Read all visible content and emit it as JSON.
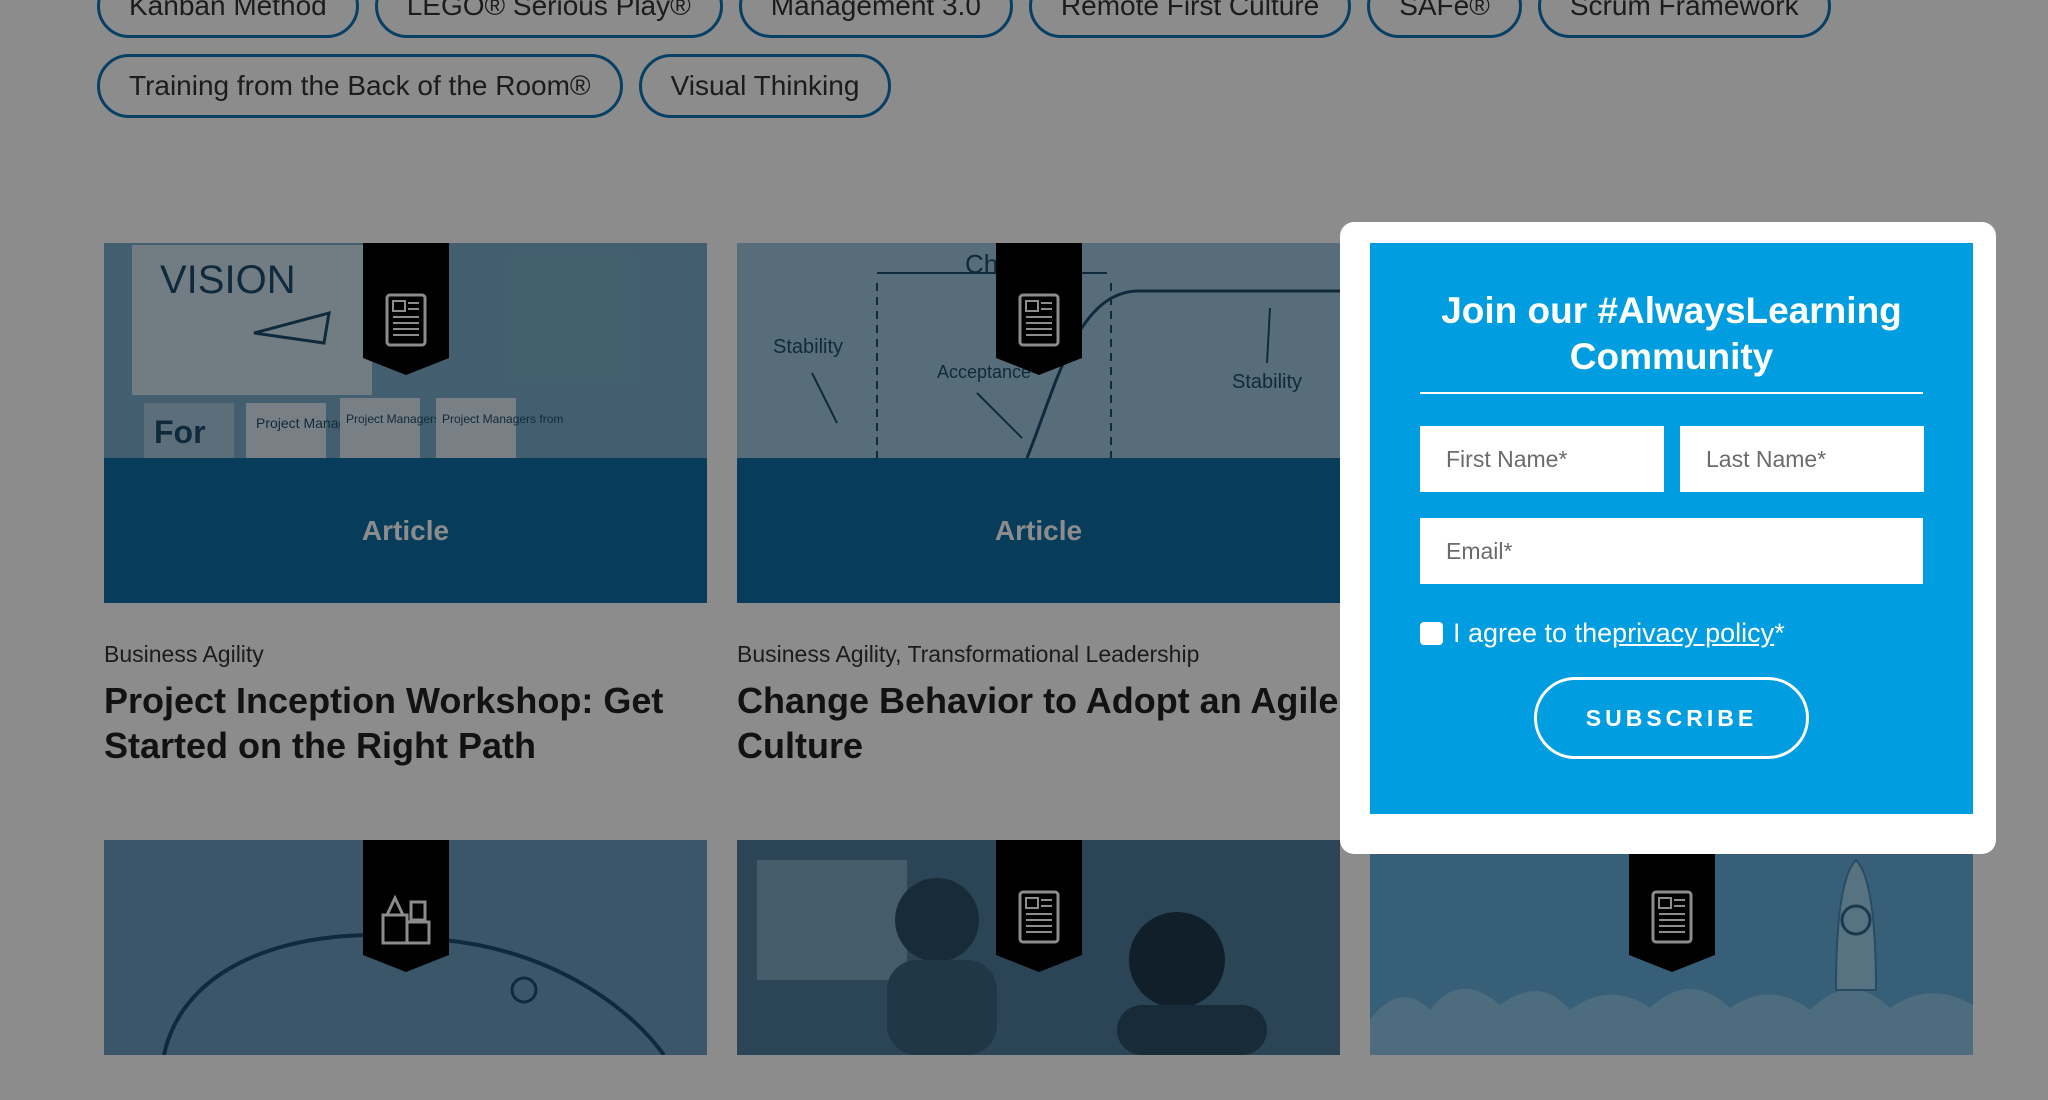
{
  "tags": {
    "row1": [
      "Kanban Method",
      "LEGO® Serious Play®",
      "Management 3.0",
      "Remote First Culture",
      "SAFe®",
      "Scrum Framework"
    ],
    "row2": [
      "Training from the Back of the Room®",
      "Visual Thinking"
    ]
  },
  "cards": [
    {
      "type": "Article",
      "categories": "Business Agility",
      "title": "Project Inception Workshop: Get Started on the Right Path",
      "image_text": {
        "vision": "VISION",
        "for": "For",
        "sticky1": "Project Managers",
        "sticky2": "Project Managers from other",
        "sticky3": "Project Managers from"
      },
      "icon": "document-icon"
    },
    {
      "type": "Article",
      "categories": "Business Agility, Transformational Leadership",
      "title": "Change Behavior to Adopt an Agile Culture",
      "image_text": {
        "cha": "Cha",
        "stability1": "Stability",
        "acceptance": "Acceptance",
        "stability2": "Stability"
      },
      "icon": "document-icon"
    }
  ],
  "bottom_cards_icons": [
    "building-blocks-icon",
    "document-icon",
    "document-icon"
  ],
  "modal": {
    "heading": "Join our #AlwaysLearning Community",
    "first_name_placeholder": "First Name*",
    "last_name_placeholder": "Last Name*",
    "email_placeholder": "Email*",
    "agree_prefix": "I agree to the ",
    "agree_link": "privacy policy",
    "agree_suffix": "*",
    "subscribe_label": "SUBSCRIBE"
  },
  "colors": {
    "brand_blue": "#009de0",
    "dark_blue": "#0d6ea7",
    "overlay": "rgba(0,0,0,0.45)"
  }
}
